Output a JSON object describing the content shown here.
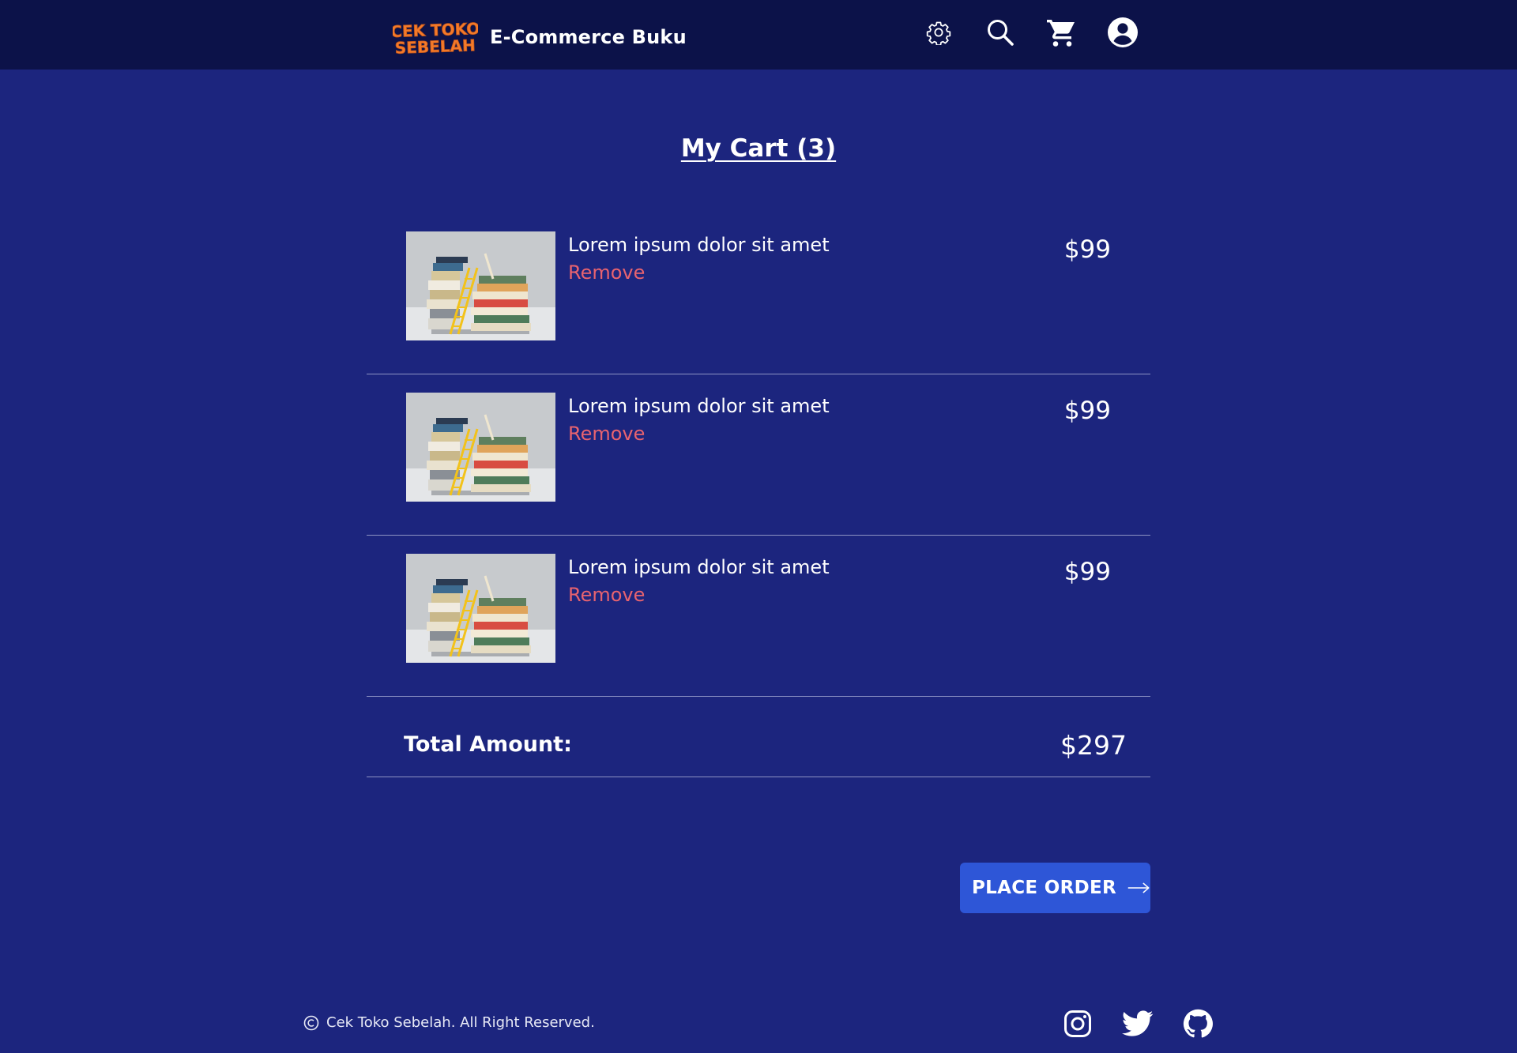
{
  "header": {
    "logo_text": "CEK TOKO SEBELAH",
    "brand_title": "E-Commerce Buku",
    "icons": [
      "gear-icon",
      "search-icon",
      "cart-icon",
      "user-account-icon"
    ]
  },
  "cart": {
    "title": "My Cart (3)",
    "items": [
      {
        "name": "Lorem ipsum dolor sit amet",
        "remove_label": "Remove",
        "price": "$99"
      },
      {
        "name": "Lorem ipsum dolor sit amet",
        "remove_label": "Remove",
        "price": "$99"
      },
      {
        "name": "Lorem ipsum dolor sit amet",
        "remove_label": "Remove",
        "price": "$99"
      }
    ],
    "total_label": "Total Amount:",
    "total_value": "$297",
    "place_order_label": "PLACE ORDER"
  },
  "footer": {
    "copyright": "Cek Toko Sebelah. All Right Reserved.",
    "social_icons": [
      "instagram-icon",
      "twitter-icon",
      "github-icon"
    ]
  },
  "colors": {
    "page_background": "#1c257e",
    "navbar_background": "#0c1249",
    "remove_link": "#e8636f",
    "button": "#2e56d7",
    "logo_orange": "#f47a2a"
  }
}
